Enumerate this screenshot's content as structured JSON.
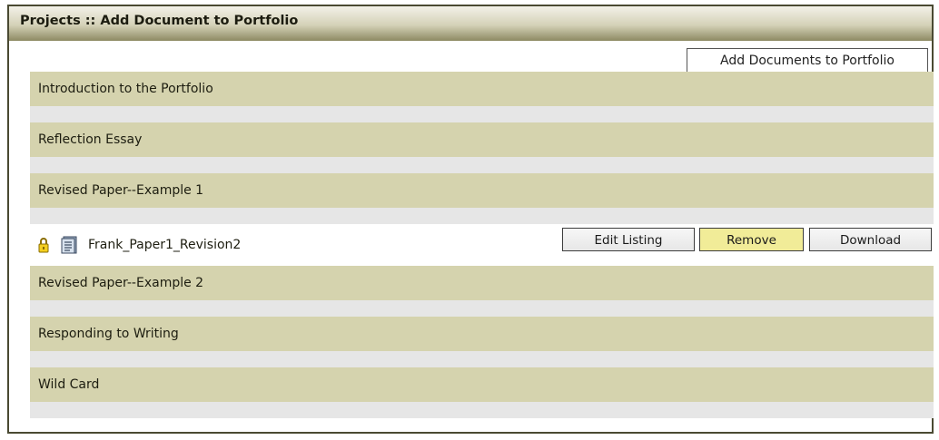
{
  "page": {
    "title": "Projects :: Add Document to Portfolio",
    "tab_label": "Add Documents to Portfolio"
  },
  "sections": [
    {
      "label": "Introduction to the Portfolio"
    },
    {
      "label": "Reflection Essay"
    },
    {
      "label": "Revised Paper--Example 1"
    },
    {
      "label": "Revised Paper--Example 2"
    },
    {
      "label": "Responding to Writing"
    },
    {
      "label": "Wild Card"
    }
  ],
  "document": {
    "name": "Frank_Paper1_Revision2",
    "lock_icon": "padlock-icon",
    "file_icon": "document-icon",
    "edit_label": "Edit Listing",
    "remove_label": "Remove",
    "download_label": "Download"
  },
  "colors": {
    "section_bg": "#d5d3ae",
    "gap_bg": "#e6e6e6",
    "remove_button": "#f1ec98"
  }
}
